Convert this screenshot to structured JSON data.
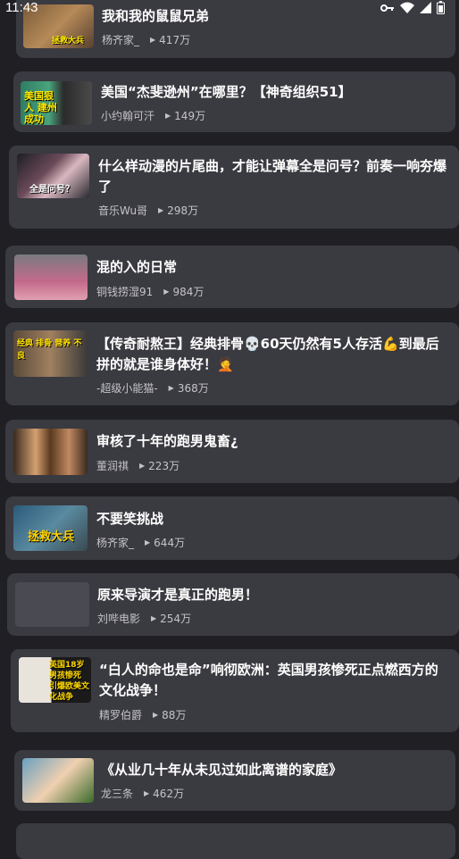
{
  "status_bar": {
    "time": "11:43"
  },
  "items": [
    {
      "title": "我和我的鼠鼠兄弟",
      "author": "杨齐家_",
      "views": "417万",
      "thumb_text": "拯救大兵"
    },
    {
      "title": "美国“杰斐逊州”在哪里？【神奇组织51】",
      "author": "小约翰可汗",
      "views": "149万",
      "thumb_text": "美国狠人 建州成功"
    },
    {
      "title": "什么样动漫的片尾曲，才能让弹幕全是问号？前奏一响夯爆了",
      "author": "音乐Wu哥",
      "views": "298万",
      "thumb_text": "全是问号？"
    },
    {
      "title": "混的入的日常",
      "author": "铜钱捞湿91",
      "views": "984万",
      "thumb_text": ""
    },
    {
      "title": "【传奇耐熬王】经典排骨💀60天仍然有5人存活💪到最后拼的就是谁身体好！🤦",
      "author": "-超级小能猫-",
      "views": "368万",
      "thumb_text": "经典 排骨 营养 不良"
    },
    {
      "title": "审核了十年的跑男鬼畜¿",
      "author": "董润祺",
      "views": "223万",
      "thumb_text": ""
    },
    {
      "title": "不要笑挑战",
      "author": "杨齐家_",
      "views": "644万",
      "thumb_text": "拯救大兵"
    },
    {
      "title": "原来导演才是真正的跑男！",
      "author": "刘哔电影",
      "views": "254万",
      "thumb_text": ""
    },
    {
      "title": "“白人的命也是命”响彻欧洲：英国男孩惨死正点燃西方的文化战争！",
      "author": "精罗伯爵",
      "views": "88万",
      "thumb_text": "英国18岁 男孩惨死 引爆欧美文化战争"
    },
    {
      "title": "《从业几十年从未见过如此离谱的家庭》",
      "author": "龙三条",
      "views": "462万",
      "thumb_text": ""
    }
  ]
}
